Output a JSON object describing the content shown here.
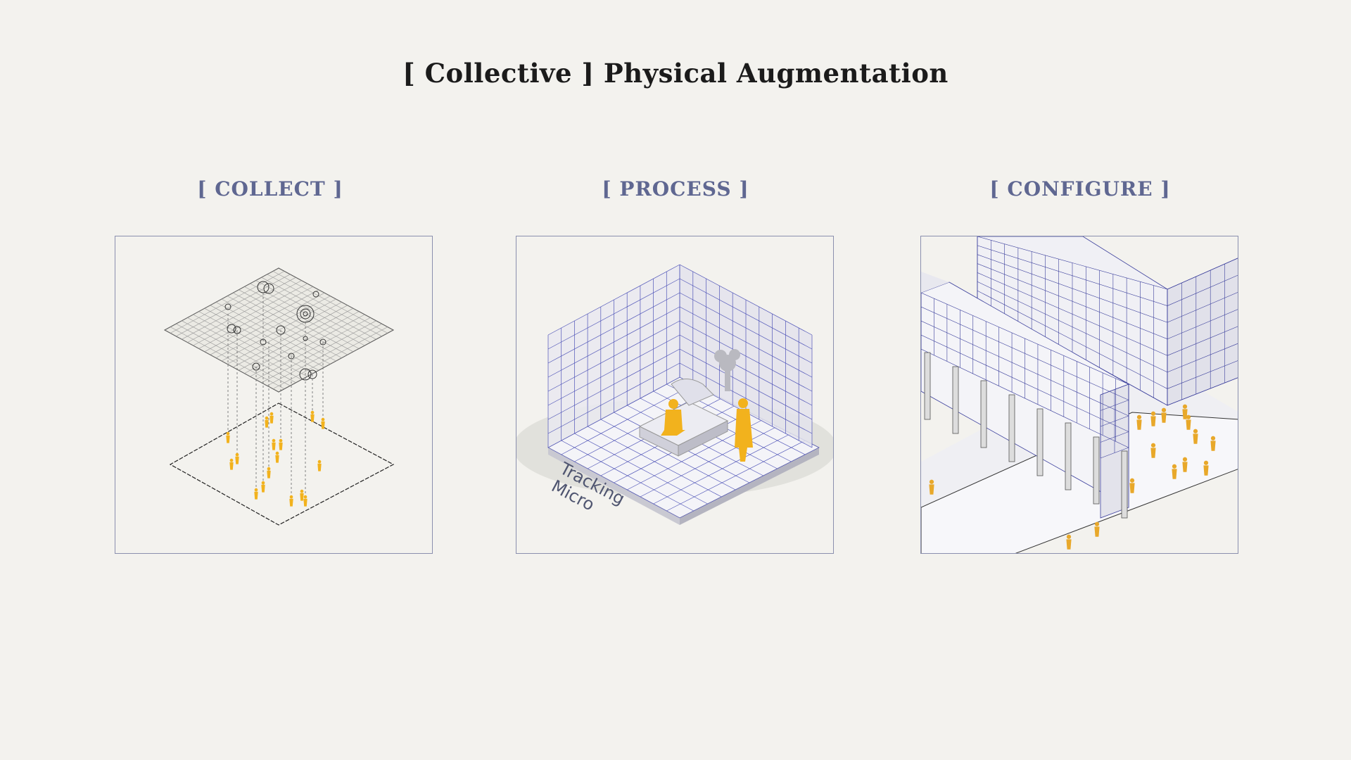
{
  "title": "[ Collective ] Physical Augmentation",
  "sections": [
    {
      "heading": "[ COLLECT ]"
    },
    {
      "heading": "[ PROCESS ]",
      "floor_label_line1": "Tracking",
      "floor_label_line2": "Micro"
    },
    {
      "heading": "[ CONFIGURE ]"
    }
  ],
  "colors": {
    "background": "#f3f2ee",
    "heading": "#5f6791",
    "grid": "#4a4fb0",
    "figure": "#f2b21d"
  }
}
